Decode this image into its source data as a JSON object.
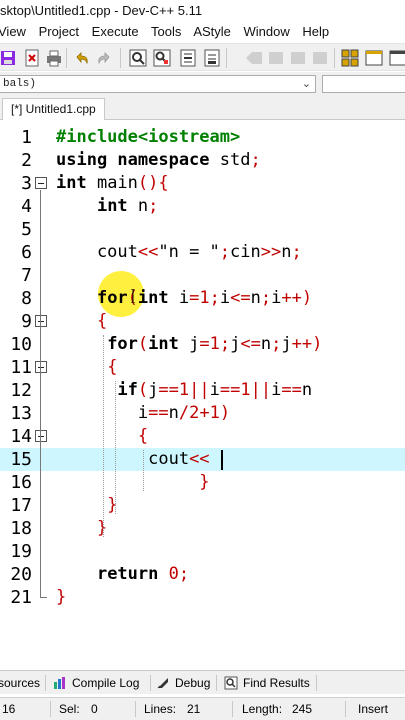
{
  "window": {
    "title": "sktop\\Untitled1.cpp - Dev-C++ 5.11"
  },
  "menu": {
    "items": [
      "View",
      "Project",
      "Execute",
      "Tools",
      "AStyle",
      "Window",
      "Help"
    ]
  },
  "combo": {
    "value": "bals)",
    "arrow": "⌄"
  },
  "tabs": [
    {
      "label": "[*] Untitled1.cpp"
    }
  ],
  "editor": {
    "active_line": 15,
    "lines": [
      {
        "n": "1",
        "fold": "none",
        "code": [
          {
            "t": "#include<iostream>",
            "c": "pp"
          }
        ]
      },
      {
        "n": "2",
        "fold": "none",
        "code": [
          {
            "t": "using namespace",
            "c": "kw"
          },
          {
            "t": " std",
            "c": ""
          },
          {
            "t": ";",
            "c": "op"
          }
        ]
      },
      {
        "n": "3",
        "fold": "open",
        "code": [
          {
            "t": "int",
            "c": "kw"
          },
          {
            "t": " main",
            "c": ""
          },
          {
            "t": "(){",
            "c": "op"
          }
        ]
      },
      {
        "n": "4",
        "fold": "none",
        "code": [
          {
            "t": "    ",
            "c": ""
          },
          {
            "t": "int",
            "c": "kw"
          },
          {
            "t": " n",
            "c": ""
          },
          {
            "t": ";",
            "c": "op"
          }
        ]
      },
      {
        "n": "5",
        "fold": "none",
        "code": []
      },
      {
        "n": "6",
        "fold": "none",
        "code": [
          {
            "t": "    cout",
            "c": ""
          },
          {
            "t": "<<",
            "c": "op"
          },
          {
            "t": "\"n = \"",
            "c": "str"
          },
          {
            "t": ";",
            "c": "op"
          },
          {
            "t": "cin",
            "c": ""
          },
          {
            "t": ">>",
            "c": "op"
          },
          {
            "t": "n",
            "c": ""
          },
          {
            "t": ";",
            "c": "op"
          }
        ]
      },
      {
        "n": "7",
        "fold": "none",
        "code": []
      },
      {
        "n": "8",
        "fold": "none",
        "code": [
          {
            "t": "    ",
            "c": ""
          },
          {
            "t": "for",
            "c": "kw"
          },
          {
            "t": "(",
            "c": "op"
          },
          {
            "t": "int",
            "c": "kw"
          },
          {
            "t": " i",
            "c": ""
          },
          {
            "t": "=",
            "c": "op"
          },
          {
            "t": "1",
            "c": "num"
          },
          {
            "t": ";",
            "c": "op"
          },
          {
            "t": "i",
            "c": ""
          },
          {
            "t": "<=",
            "c": "op"
          },
          {
            "t": "n",
            "c": ""
          },
          {
            "t": ";",
            "c": "op"
          },
          {
            "t": "i",
            "c": ""
          },
          {
            "t": "++)",
            "c": "op"
          }
        ]
      },
      {
        "n": "9",
        "fold": "open",
        "code": [
          {
            "t": "    ",
            "c": ""
          },
          {
            "t": "{",
            "c": "op"
          }
        ]
      },
      {
        "n": "10",
        "fold": "none",
        "code": [
          {
            "t": "     ",
            "c": ""
          },
          {
            "t": "for",
            "c": "kw"
          },
          {
            "t": "(",
            "c": "op"
          },
          {
            "t": "int",
            "c": "kw"
          },
          {
            "t": " j",
            "c": ""
          },
          {
            "t": "=",
            "c": "op"
          },
          {
            "t": "1",
            "c": "num"
          },
          {
            "t": ";",
            "c": "op"
          },
          {
            "t": "j",
            "c": ""
          },
          {
            "t": "<=",
            "c": "op"
          },
          {
            "t": "n",
            "c": ""
          },
          {
            "t": ";",
            "c": "op"
          },
          {
            "t": "j",
            "c": ""
          },
          {
            "t": "++)",
            "c": "op"
          }
        ]
      },
      {
        "n": "11",
        "fold": "open",
        "code": [
          {
            "t": "     ",
            "c": ""
          },
          {
            "t": "{",
            "c": "op"
          }
        ]
      },
      {
        "n": "12",
        "fold": "none",
        "code": [
          {
            "t": "      ",
            "c": ""
          },
          {
            "t": "if",
            "c": "kw"
          },
          {
            "t": "(",
            "c": "op"
          },
          {
            "t": "j",
            "c": ""
          },
          {
            "t": "==",
            "c": "op"
          },
          {
            "t": "1",
            "c": "num"
          },
          {
            "t": "||",
            "c": "op"
          },
          {
            "t": "i",
            "c": ""
          },
          {
            "t": "==",
            "c": "op"
          },
          {
            "t": "1",
            "c": "num"
          },
          {
            "t": "||",
            "c": "op"
          },
          {
            "t": "i",
            "c": ""
          },
          {
            "t": "==",
            "c": "op"
          },
          {
            "t": "n",
            "c": ""
          }
        ]
      },
      {
        "n": "13",
        "fold": "none",
        "code": [
          {
            "t": "        i",
            "c": ""
          },
          {
            "t": "==",
            "c": "op"
          },
          {
            "t": "n",
            "c": ""
          },
          {
            "t": "/",
            "c": "op"
          },
          {
            "t": "2",
            "c": "num"
          },
          {
            "t": "+",
            "c": "op"
          },
          {
            "t": "1",
            "c": "num"
          },
          {
            "t": ")",
            "c": "op"
          }
        ]
      },
      {
        "n": "14",
        "fold": "open",
        "code": [
          {
            "t": "        ",
            "c": ""
          },
          {
            "t": "{",
            "c": "op"
          }
        ]
      },
      {
        "n": "15",
        "fold": "none",
        "code": [
          {
            "t": "         cout",
            "c": ""
          },
          {
            "t": "<<",
            "c": "op"
          }
        ]
      },
      {
        "n": "16",
        "fold": "none",
        "code": [
          {
            "t": "              ",
            "c": ""
          },
          {
            "t": "}",
            "c": "op"
          }
        ]
      },
      {
        "n": "17",
        "fold": "none",
        "code": [
          {
            "t": "     ",
            "c": ""
          },
          {
            "t": "}",
            "c": "op"
          }
        ]
      },
      {
        "n": "18",
        "fold": "none",
        "code": [
          {
            "t": "    ",
            "c": ""
          },
          {
            "t": "}",
            "c": "op"
          }
        ]
      },
      {
        "n": "19",
        "fold": "none",
        "code": []
      },
      {
        "n": "20",
        "fold": "none",
        "code": [
          {
            "t": "    ",
            "c": ""
          },
          {
            "t": "return",
            "c": "kw"
          },
          {
            "t": " ",
            "c": ""
          },
          {
            "t": "0",
            "c": "num"
          },
          {
            "t": ";",
            "c": "op"
          }
        ]
      },
      {
        "n": "21",
        "fold": "end",
        "code": [
          {
            "t": "}",
            "c": "op"
          }
        ]
      }
    ]
  },
  "bottom_tabs": {
    "resources": "sources",
    "compile_log": "Compile Log",
    "debug": "Debug",
    "find_results": "Find Results"
  },
  "status": {
    "line_value": "16",
    "sel_label": "Sel:",
    "sel_value": "0",
    "lines_label": "Lines:",
    "lines_value": "21",
    "length_label": "Length:",
    "length_value": "245",
    "mode": "Insert"
  },
  "colors": {
    "active_line": "#cdf6ff",
    "keyword": "#000000",
    "preprocessor": "#008000",
    "operator": "#c00000",
    "highlight": "#ffeb00"
  }
}
